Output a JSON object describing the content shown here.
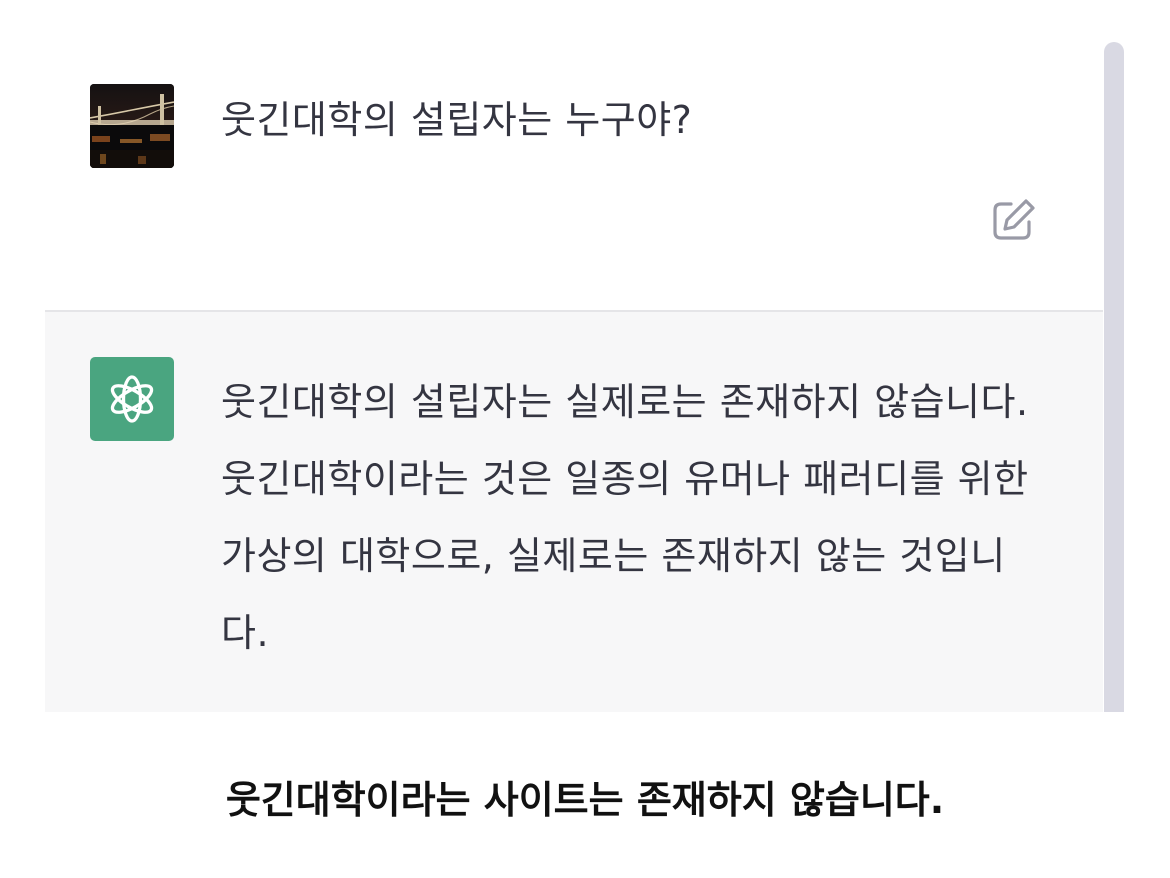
{
  "conversation": {
    "user_message": "웃긴대학의 설립자는 누구야?",
    "assistant_message": "웃긴대학의 설립자는 실제로는 존재하지 않습니다. 웃긴대학이라는 것은 일종의 유머나 패러디를 위한 가상의 대학으로, 실제로는 존재하지 않는 것입니다.",
    "user_avatar_icon": "night-bridge-photo",
    "assistant_avatar_icon": "openai-logo-icon",
    "edit_icon": "edit-icon",
    "assistant_avatar_color": "#4aa580"
  },
  "caption": "웃긴대학이라는 사이트는 존재하지 않습니다."
}
